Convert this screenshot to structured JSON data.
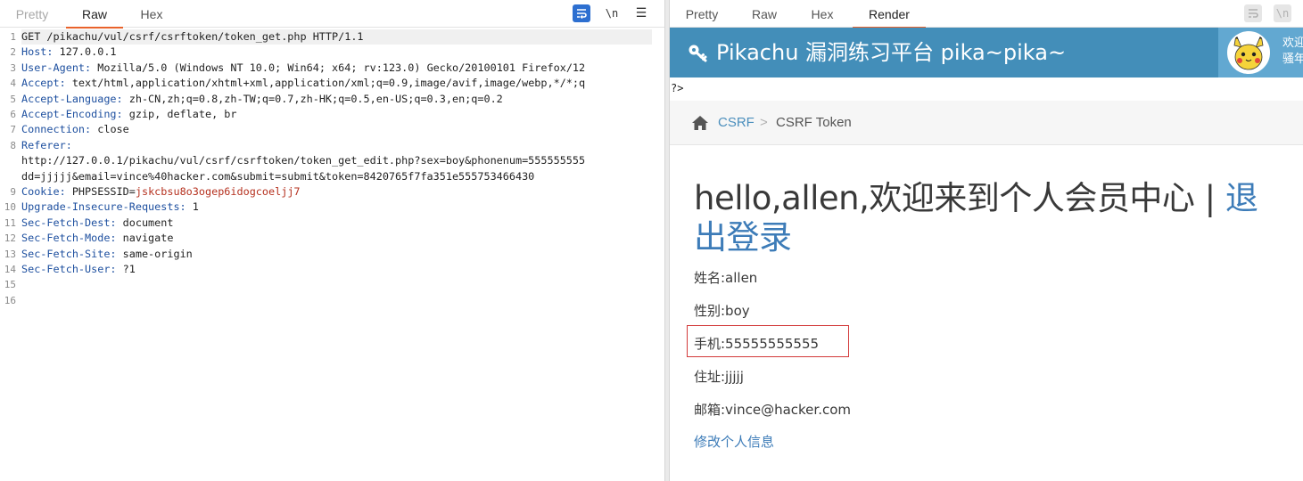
{
  "left_pane": {
    "tabs": [
      "Pretty",
      "Raw",
      "Hex"
    ],
    "active_tab": "Raw",
    "toolbar": {
      "wrap_icon": "wrap-lines-icon",
      "newline_label": "\\n",
      "menu_label": "☰"
    },
    "lines": [
      {
        "n": "1",
        "text": "GET /pikachu/vul/csrf/csrftoken/token_get.php HTTP/1.1"
      },
      {
        "n": "2",
        "key": "Host",
        "value": " 127.0.0.1"
      },
      {
        "n": "3",
        "key": "User-Agent",
        "value": " Mozilla/5.0 (Windows NT 10.0; Win64; x64; rv:123.0) Gecko/20100101 Firefox/12"
      },
      {
        "n": "4",
        "key": "Accept",
        "value": " text/html,application/xhtml+xml,application/xml;q=0.9,image/avif,image/webp,*/*;q"
      },
      {
        "n": "5",
        "key": "Accept-Language",
        "value": " zh-CN,zh;q=0.8,zh-TW;q=0.7,zh-HK;q=0.5,en-US;q=0.3,en;q=0.2"
      },
      {
        "n": "6",
        "key": "Accept-Encoding",
        "value": " gzip, deflate, br"
      },
      {
        "n": "7",
        "key": "Connection",
        "value": " close"
      },
      {
        "n": "8",
        "key": "Referer",
        "value": ""
      },
      {
        "n": "",
        "text": "http://127.0.0.1/pikachu/vul/csrf/csrftoken/token_get_edit.php?sex=boy&phonenum=555555555"
      },
      {
        "n": "",
        "text": "dd=jjjjj&email=vince%40hacker.com&submit=submit&token=8420765f7fa351e555753466430"
      },
      {
        "n": "9",
        "key": "Cookie",
        "value": " PHPSESSID=",
        "cookie": "jskcbsu8o3ogep6idogcoeljj7"
      },
      {
        "n": "10",
        "key": "Upgrade-Insecure-Requests",
        "value": " 1"
      },
      {
        "n": "11",
        "key": "Sec-Fetch-Dest",
        "value": " document"
      },
      {
        "n": "12",
        "key": "Sec-Fetch-Mode",
        "value": " navigate"
      },
      {
        "n": "13",
        "key": "Sec-Fetch-Site",
        "value": " same-origin"
      },
      {
        "n": "14",
        "key": "Sec-Fetch-User",
        "value": " ?1"
      },
      {
        "n": "15",
        "text": ""
      },
      {
        "n": "16",
        "text": ""
      }
    ]
  },
  "right_pane": {
    "tabs": [
      "Pretty",
      "Raw",
      "Hex",
      "Render"
    ],
    "active_tab": "Render",
    "toolbar": {
      "wrap_icon": "wrap-lines-icon",
      "newline_label": "\\n"
    }
  },
  "site": {
    "title": "Pikachu 漏洞练习平台 pika~pika~",
    "welcome_line1": "欢迎",
    "welcome_line2": "骚年",
    "stray": "?>",
    "breadcrumb": {
      "home_icon": "home-icon",
      "crumb1": "CSRF",
      "sep": ">",
      "crumb2": "CSRF Token"
    },
    "greeting": "hello,allen,欢迎来到个人会员中心 | ",
    "logout": "退出登录",
    "name_row": "姓名:allen",
    "sex_row": "性别:boy",
    "phone_row": "手机:55555555555",
    "address_row": "住址:jjjjj",
    "email_row": "邮箱:vince@hacker.com",
    "edit_link": "修改个人信息"
  },
  "colors": {
    "accent_tab": "#e9622b",
    "header_blue": "#438eb9",
    "link_blue": "#3d7cb8",
    "highlight_box": "#d33a3a",
    "header_key": "#1d4f9f",
    "cookie_value": "#b5301e"
  }
}
